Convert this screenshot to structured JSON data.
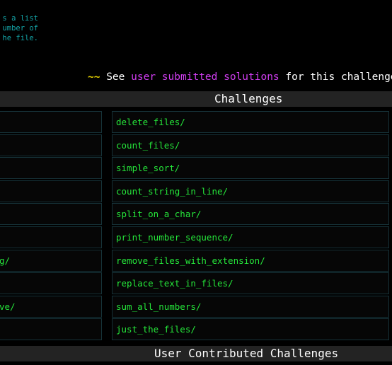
{
  "intro": {
    "lines": [
      "s a list",
      "umber of",
      "he file."
    ]
  },
  "solutions": {
    "squiggle": "~~",
    "prefix": "See",
    "link": "user submitted solutions",
    "suffix": "for this challenge"
  },
  "sections": {
    "challenges": "Challenges",
    "user_contributed": "User Contributed Challenges"
  },
  "left_column": {
    "items": [
      "",
      "",
      "",
      "",
      "",
      "",
      "g/",
      "",
      "ve/",
      ""
    ]
  },
  "right_column": {
    "items": [
      "delete_files/",
      "count_files/",
      "simple_sort/",
      "count_string_in_line/",
      "split_on_a_char/",
      "print_number_sequence/",
      "remove_files_with_extension/",
      "replace_text_in_files/",
      "sum_all_numbers/",
      "just_the_files/"
    ]
  },
  "colors": {
    "background": "#000000",
    "intro_text": "#14a5a8",
    "link_green": "#25e63a",
    "link_magenta": "#d23ef2",
    "squiggle_yellow": "#e6d200",
    "header_bg": "#232323",
    "cell_border": "#163238"
  }
}
